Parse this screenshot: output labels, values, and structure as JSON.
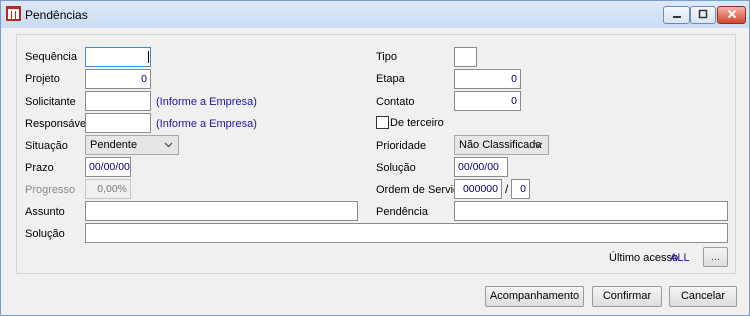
{
  "window": {
    "title": "Pendências",
    "icon": "app-logo-icon",
    "controls": {
      "minimize": "minimize-icon",
      "maximize": "maximize-icon",
      "close": "close-icon"
    }
  },
  "form": {
    "sequencia": {
      "label": "Sequência",
      "value": ""
    },
    "projeto": {
      "label": "Projeto",
      "value": "0"
    },
    "solicitante": {
      "label": "Solicitante",
      "value": "",
      "link": "(Informe a Empresa)"
    },
    "responsavel": {
      "label": "Responsável",
      "value": "",
      "link": "(Informe a Empresa)"
    },
    "situacao": {
      "label": "Situação",
      "value": "Pendente"
    },
    "prazo": {
      "label": "Prazo",
      "value": "00/00/00"
    },
    "progresso": {
      "label": "Progresso",
      "value": "0,00%"
    },
    "assunto": {
      "label": "Assunto",
      "value": ""
    },
    "solucao_text": {
      "label": "Solução",
      "value": ""
    },
    "tipo": {
      "label": "Tipo",
      "value": ""
    },
    "etapa": {
      "label": "Etapa",
      "value": "0"
    },
    "contato": {
      "label": "Contato",
      "value": "0"
    },
    "de_terceiro": {
      "label": "De terceiro",
      "checked": false
    },
    "prioridade": {
      "label": "Prioridade",
      "value": "Não Classificada"
    },
    "solucao_date": {
      "label": "Solução",
      "value": "00/00/00"
    },
    "ordem_servico": {
      "label": "Ordem de Serviço",
      "value": "000000",
      "separator": "/",
      "item": "0"
    },
    "pendencia": {
      "label": "Pendência",
      "value": ""
    },
    "ultimo_acesso": {
      "label": "Último acesso",
      "value": "ALL",
      "button": "..."
    }
  },
  "buttons": {
    "acompanhamento": "Acompanhamento",
    "confirmar": "Confirmar",
    "cancelar": "Cancelar"
  }
}
